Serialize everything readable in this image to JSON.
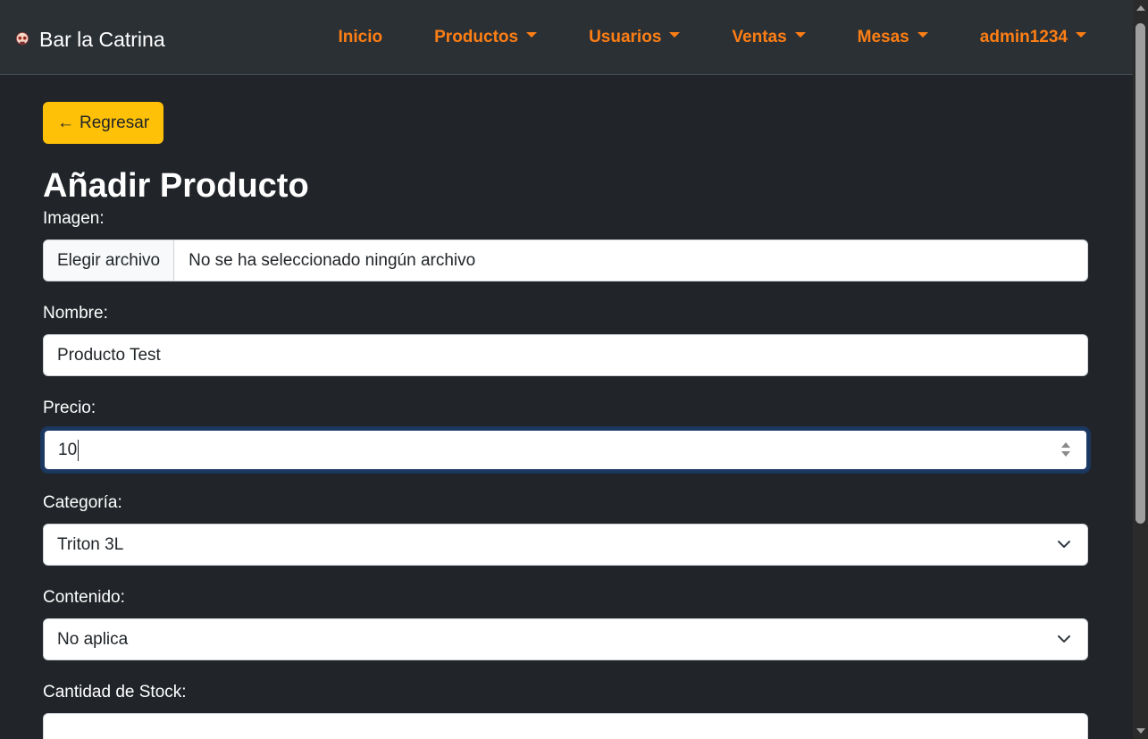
{
  "brand": {
    "name": "Bar la Catrina",
    "logo_icon": "skull-icon"
  },
  "nav": {
    "inicio": "Inicio",
    "productos": "Productos",
    "usuarios": "Usuarios",
    "ventas": "Ventas",
    "mesas": "Mesas",
    "user": "admin1234"
  },
  "back_button": {
    "arrow": "←",
    "label": "Regresar"
  },
  "page_title": "Añadir Producto",
  "form": {
    "imagen": {
      "label": "Imagen:",
      "button": "Elegir archivo",
      "status": "No se ha seleccionado ningún archivo"
    },
    "nombre": {
      "label": "Nombre:",
      "value": "Producto Test"
    },
    "precio": {
      "label": "Precio:",
      "value": "10"
    },
    "categoria": {
      "label": "Categoría:",
      "selected": "Triton 3L"
    },
    "contenido": {
      "label": "Contenido:",
      "selected": "No aplica"
    },
    "stock": {
      "label": "Cantidad de Stock:",
      "value": ""
    }
  },
  "colors": {
    "background": "#212529",
    "navbar": "#2b3035",
    "nav_link": "#fd7e14",
    "back_button": "#ffc107",
    "focus_border": "#1d3b66"
  }
}
